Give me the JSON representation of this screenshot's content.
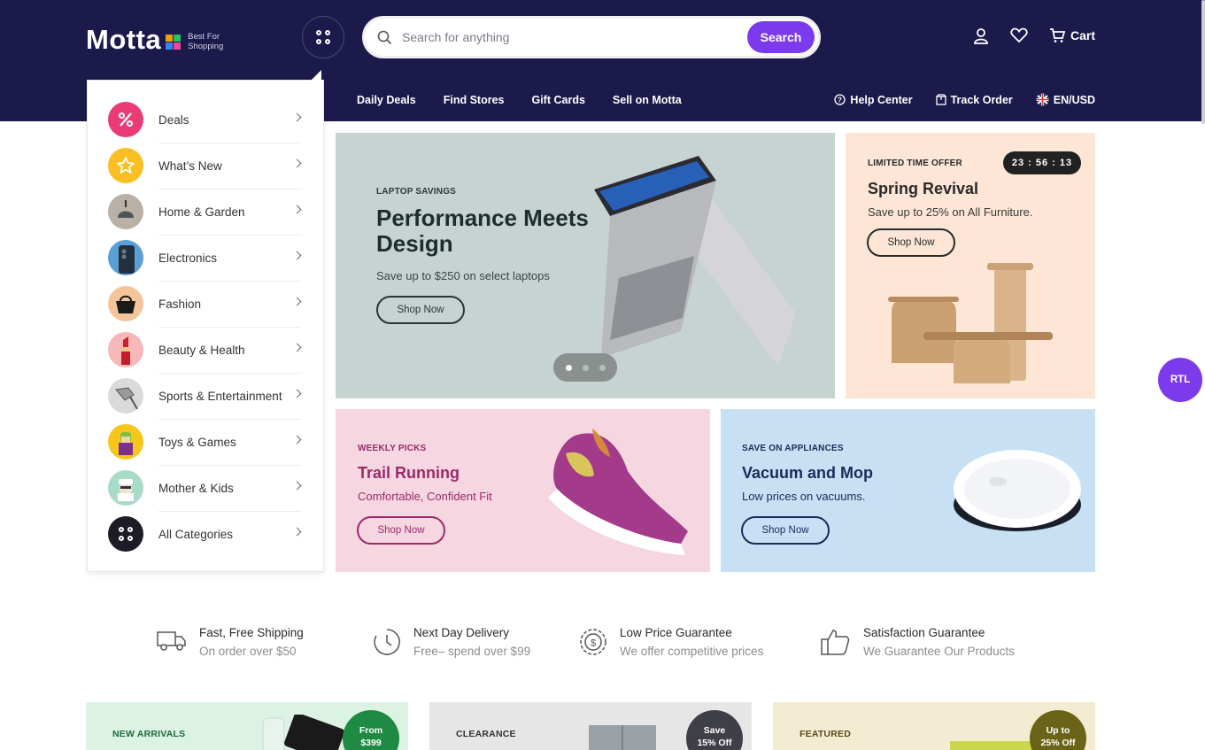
{
  "brand": {
    "name": "Motta",
    "tagline_1": "Best For",
    "tagline_2": "Shopping"
  },
  "search": {
    "placeholder": "Search for anything",
    "button": "Search"
  },
  "header_actions": {
    "cart_label": "Cart"
  },
  "nav": {
    "links": [
      "Daily Deals",
      "Find Stores",
      "Gift Cards",
      "Sell on Motta"
    ],
    "help": "Help Center",
    "track": "Track Order",
    "locale": "EN/USD"
  },
  "categories": [
    {
      "label": "Deals",
      "icon": "percent-icon"
    },
    {
      "label": "What’s New",
      "icon": "star-icon"
    },
    {
      "label": "Home & Garden",
      "icon": "lamp-icon"
    },
    {
      "label": "Electronics",
      "icon": "phone-icon"
    },
    {
      "label": "Fashion",
      "icon": "handbag-icon"
    },
    {
      "label": "Beauty & Health",
      "icon": "lipstick-icon"
    },
    {
      "label": "Sports & Entertainment",
      "icon": "golf-club-icon"
    },
    {
      "label": "Toys & Games",
      "icon": "toy-figure-icon"
    },
    {
      "label": "Mother & Kids",
      "icon": "kid-icon"
    },
    {
      "label": "All Categories",
      "icon": "grid-icon"
    }
  ],
  "hero": {
    "kicker": "LAPTOP SAVINGS",
    "title": "Performance Meets Design",
    "subtitle": "Save up to $250 on select laptops",
    "button": "Shop Now",
    "slides": 3,
    "active_slide": 1
  },
  "promo_spring": {
    "kicker": "LIMITED TIME OFFER",
    "timer": "23 : 56 : 13",
    "title": "Spring Revival",
    "subtitle": "Save up to 25% on All Furniture.",
    "button": "Shop Now"
  },
  "promo_shoes": {
    "kicker": "WEEKLY PICKS",
    "title": "Trail Running",
    "subtitle": "Comfortable, Confident Fit",
    "button": "Shop Now"
  },
  "promo_vacuum": {
    "kicker": "SAVE ON APPLIANCES",
    "title": "Vacuum and Mop",
    "subtitle": "Low prices on vacuums.",
    "button": "Shop Now"
  },
  "rtl_label": "RTL",
  "features": [
    {
      "title": "Fast, Free Shipping",
      "subtitle": "On order over $50",
      "icon": "truck-icon"
    },
    {
      "title": "Next Day Delivery",
      "subtitle": "Free– spend over $99",
      "icon": "clock-icon"
    },
    {
      "title": "Low Price Guarantee",
      "subtitle": "We offer competitive prices",
      "icon": "dollar-badge-icon"
    },
    {
      "title": "Satisfaction Guarantee",
      "subtitle": "We Guarantee Our Products",
      "icon": "thumbs-up-icon"
    }
  ],
  "cards": [
    {
      "kicker": "NEW ARRIVALS",
      "badge_1": "From",
      "badge_2": "$399"
    },
    {
      "kicker": "CLEARANCE",
      "badge_1": "Save",
      "badge_2": "15% Off"
    },
    {
      "kicker": "FEATURED",
      "badge_1": "Up to",
      "badge_2": "25% Off"
    }
  ],
  "colors": {
    "header_bg": "#1c1a4b",
    "accent": "#7c3aed",
    "hero_bg": "#c7d3d1",
    "spring_bg": "#fde6d6",
    "shoes_bg": "#f6d6e0",
    "vacuum_bg": "#c8e0f3"
  }
}
